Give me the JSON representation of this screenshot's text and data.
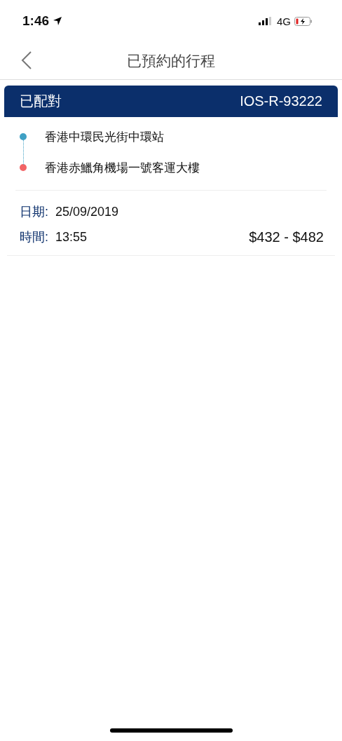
{
  "status_bar": {
    "time": "1:46",
    "network": "4G"
  },
  "nav": {
    "title": "已預約的行程"
  },
  "booking": {
    "status": "已配對",
    "reference": "IOS-R-93222",
    "stops": [
      {
        "name": "香港中環民光街中環站",
        "color": "#3fa0c4"
      },
      {
        "name": "香港赤鱲角機場一號客運大樓",
        "color": "#f26466"
      }
    ],
    "date_label": "日期:",
    "date": "25/09/2019",
    "time_label": "時間:",
    "time": "13:55",
    "price": "$432 - $482"
  }
}
